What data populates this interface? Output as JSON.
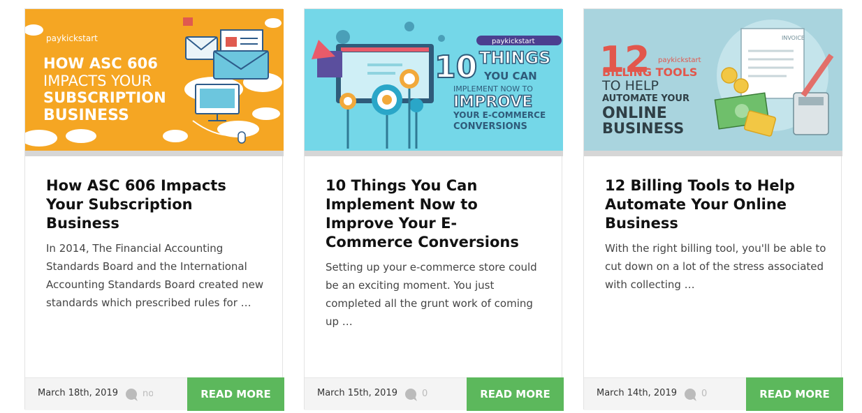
{
  "colors": {
    "accent_green": "#5cb85c",
    "orange_bg": "#f5a623",
    "cyan_bg": "#74d7e8",
    "blue_bg": "#a9d4de",
    "text_dark": "#111111"
  },
  "posts": [
    {
      "thumb": {
        "logo": "paykickstart",
        "lines": [
          "HOW ASC 606",
          "IMPACTS YOUR",
          "SUBSCRIPTION",
          "BUSINESS"
        ]
      },
      "title": "How ASC 606 Impacts Your Subscription Business",
      "excerpt": "In 2014, The Financial Accounting Standards Board and the International Accounting Standards Board created new standards which prescribed rules for …",
      "date": "March 18th, 2019",
      "comments": "no",
      "read_more": "READ MORE"
    },
    {
      "thumb": {
        "logo": "paykickstart",
        "lines": [
          "10",
          "THINGS",
          "YOU CAN",
          "IMPLEMENT NOW TO",
          "IMPROVE",
          "YOUR E-COMMERCE",
          "CONVERSIONS"
        ]
      },
      "title": "10 Things You Can Implement Now to Improve Your E-Commerce Conversions",
      "excerpt": "Setting up your e-commerce store could be an exciting moment. You just completed all the grunt work of coming up …",
      "date": "March 15th, 2019",
      "comments": "0",
      "read_more": "READ MORE"
    },
    {
      "thumb": {
        "logo": "paykickstart",
        "lines": [
          "12",
          "BILLING TOOLS",
          "TO HELP",
          "AUTOMATE YOUR",
          "ONLINE",
          "BUSINESS",
          "INVOICE"
        ]
      },
      "title": "12 Billing Tools to Help Automate Your Online Business",
      "excerpt": "With the right billing tool, you'll be able to cut down on a lot of the stress associated with collecting …",
      "date": "March 14th, 2019",
      "comments": "0",
      "read_more": "READ MORE"
    }
  ]
}
